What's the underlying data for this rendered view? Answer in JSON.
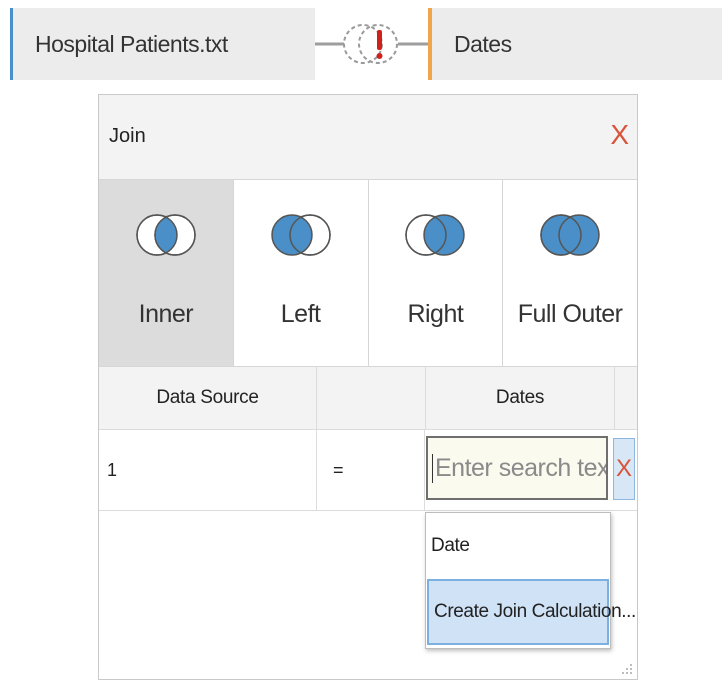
{
  "canvas": {
    "left_source": "Hospital Patients.txt",
    "right_source": "Dates"
  },
  "join": {
    "title": "Join",
    "close_symbol": "X",
    "types": [
      {
        "label": "Inner",
        "icon": "inner-join-icon",
        "active": true
      },
      {
        "label": "Left",
        "icon": "left-join-icon",
        "active": false
      },
      {
        "label": "Right",
        "icon": "right-join-icon",
        "active": false
      },
      {
        "label": "Full Outer",
        "icon": "full-outer-join-icon",
        "active": false
      }
    ],
    "columns": {
      "left": "Data Source",
      "right": "Dates"
    },
    "clause": {
      "left_value": "1",
      "operator": "=",
      "remove_symbol": "X"
    },
    "search": {
      "placeholder": "Enter search text",
      "value": ""
    },
    "dropdown": [
      "Date",
      "Create Join Calculation..."
    ]
  },
  "colors": {
    "accent_blue": "#4a8fc7",
    "accent_orange": "#f0a54a",
    "close_red": "#d9533a",
    "venn_fill": "#4a8fc7",
    "warning_red": "#d0221b"
  }
}
